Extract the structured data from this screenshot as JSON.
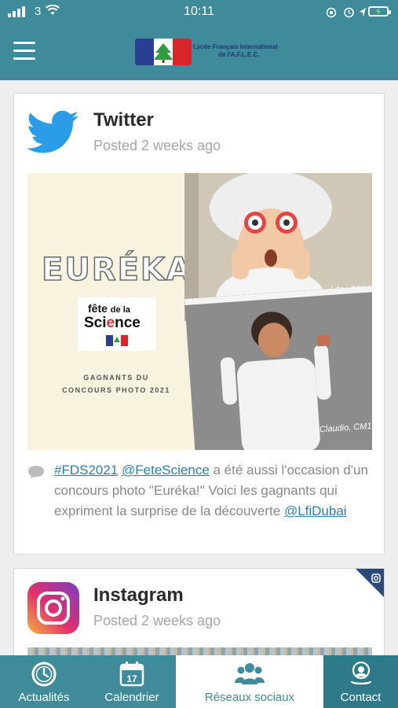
{
  "status_bar": {
    "carrier": "3",
    "time": "10:11"
  },
  "header": {
    "logo_text_line1": "Lycée Français International",
    "logo_text_line2": "de l'A.F.L.E.C."
  },
  "posts": [
    {
      "network": "Twitter",
      "posted": "Posted 2 weeks ago",
      "image": {
        "headline": "EURÉKA!",
        "logo_line1": "fête",
        "logo_line1_small": "de la",
        "logo_line2_a": "Sci",
        "logo_line2_b": "e",
        "logo_line2_c": "nce",
        "caption_line1": "GAGNANTS DU",
        "caption_line2": "CONCOURS PHOTO 2021",
        "photo1_caption": "Léo, CE2",
        "photo2_caption": "Claudio, CM1"
      },
      "text": {
        "tag1": "#FDS2021",
        "tag2": "@FeteScience",
        "body": " a été aussi l'occasion d'un concours photo \"Euréka!\" Voici les gagnants qui expriment la surprise de la découverte ",
        "tag3": "@LfiDubai"
      }
    },
    {
      "network": "Instagram",
      "posted": "Posted 2 weeks ago"
    }
  ],
  "tabs": [
    {
      "label": "Actualités",
      "icon": "clock-icon"
    },
    {
      "label": "Calendrier",
      "icon": "calendar-icon",
      "day": "17"
    },
    {
      "label": "Réseaux sociaux",
      "icon": "people-icon"
    },
    {
      "label": "Contact",
      "icon": "contact-icon"
    }
  ],
  "colors": {
    "primary": "#3f8b9c",
    "twitter_blue": "#2b9ce8",
    "link": "#2b7fb7"
  }
}
